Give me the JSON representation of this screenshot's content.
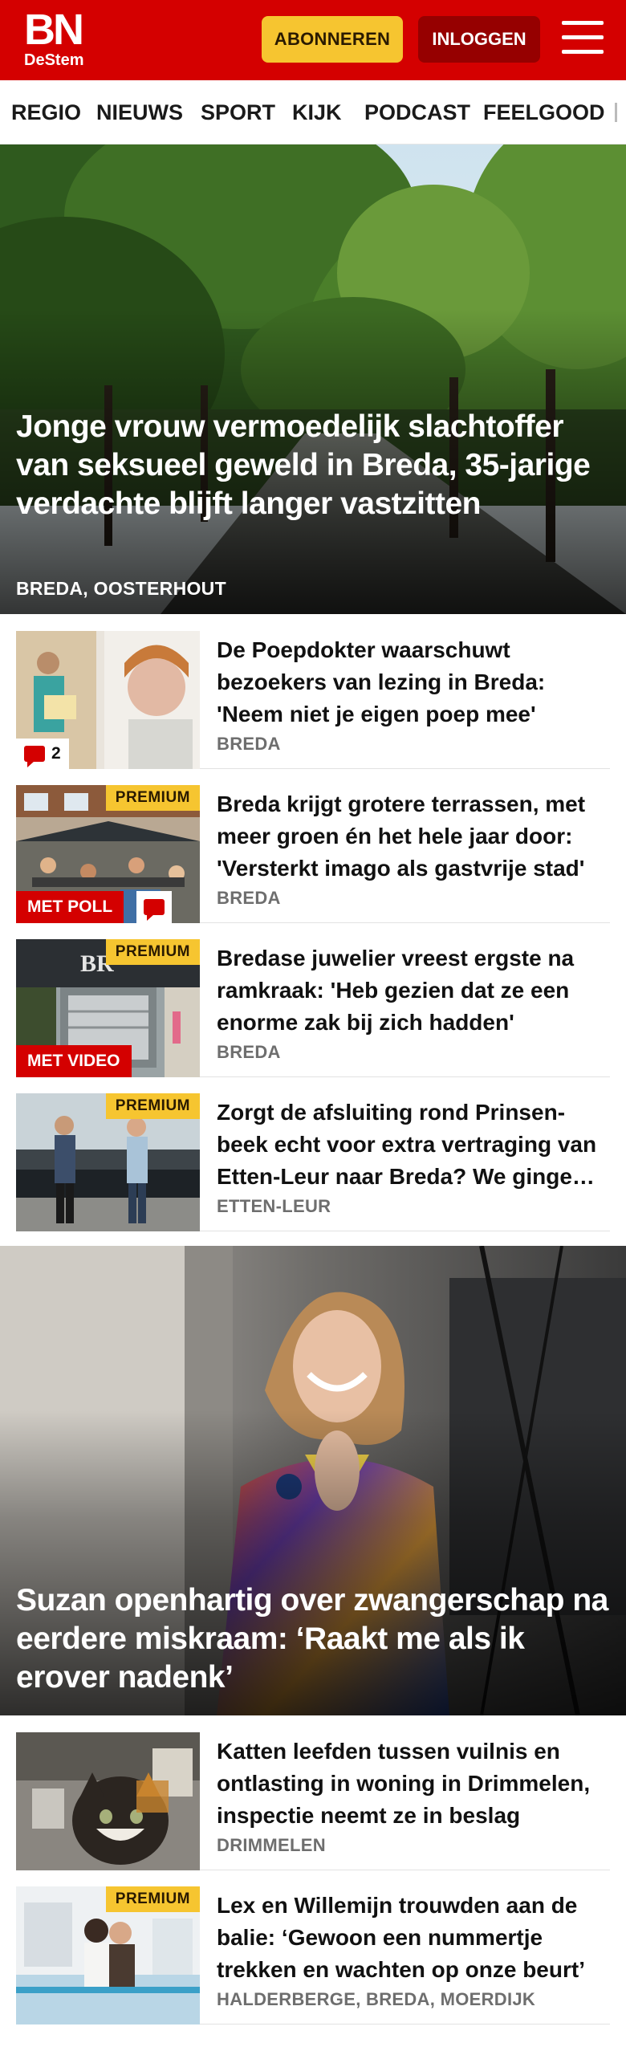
{
  "header": {
    "logo_bn": "BN",
    "logo_destem": "DeStem",
    "subscribe_label": "ABONNEREN",
    "login_label": "INLOGGEN",
    "brand_color": "#d40000",
    "accent_color": "#f6c530"
  },
  "nav": {
    "items": [
      "REGIO",
      "NIEUWS",
      "SPORT",
      "KIJK",
      "PODCAST",
      "FEELGOOD"
    ]
  },
  "hero1": {
    "title": "Jonge vrouw vermoedelijk slachtoffer van seksueel geweld in Breda, 35-jarige verdachte blijft langer vastzitten",
    "location": "BREDA, OOSTERHOUT"
  },
  "list1": [
    {
      "title": "De Poepdokter waarschuwt bezoekers van lezing in Breda: 'Neem niet je eigen poep mee'",
      "location": "BREDA",
      "comments": "2"
    },
    {
      "title": "Breda krijgt grotere terrassen, met meer groen én het hele jaar door: 'Versterkt imago als gastvrije stad'",
      "location": "BREDA",
      "premium": "PREMIUM",
      "tag": "MET POLL"
    },
    {
      "title": "Bredase juwelier vreest ergste na ramkraak: 'Heb gezien dat ze een enorme zak bij zich hadden'",
      "location": "BREDA",
      "premium": "PREMIUM",
      "tag": "MET VIDEO"
    },
    {
      "title": "Zorgt de afsluiting rond Prinsen­beek echt voor extra vertraging van Etten-Leur naar Breda? We gingen op onderzoek uit",
      "location": "ETTEN-LEUR",
      "premium": "PREMIUM"
    }
  ],
  "hero2": {
    "title": "Suzan openhartig over zwangerschap na eerdere miskraam: ‘Raakt me als ik erover nadenk’"
  },
  "list2": [
    {
      "title": "Katten leefden tussen vuilnis en ontlasting in woning in Drimmelen, inspectie neemt ze in beslag",
      "location": "DRIMMELEN"
    },
    {
      "title": "Lex en Willemijn trouwden aan de balie: ‘Gewoon een nummertje trekken en wachten op onze beurt’",
      "location": "HALDERBERGE, BREDA, MOERDIJK",
      "premium": "PREMIUM"
    }
  ]
}
